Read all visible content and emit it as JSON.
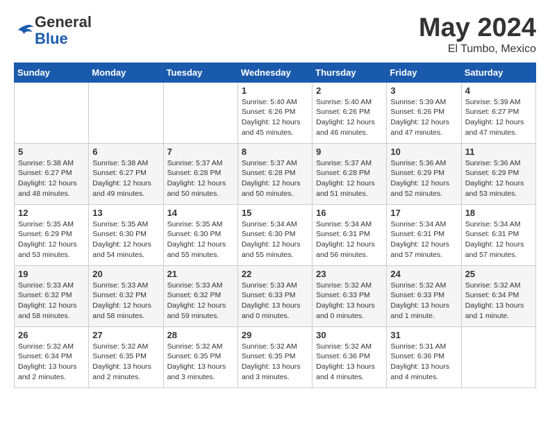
{
  "logo": {
    "general": "General",
    "blue": "Blue"
  },
  "title": "May 2024",
  "location": "El Tumbo, Mexico",
  "days_of_week": [
    "Sunday",
    "Monday",
    "Tuesday",
    "Wednesday",
    "Thursday",
    "Friday",
    "Saturday"
  ],
  "weeks": [
    [
      {
        "day": "",
        "info": ""
      },
      {
        "day": "",
        "info": ""
      },
      {
        "day": "",
        "info": ""
      },
      {
        "day": "1",
        "info": "Sunrise: 5:40 AM\nSunset: 6:26 PM\nDaylight: 12 hours\nand 45 minutes."
      },
      {
        "day": "2",
        "info": "Sunrise: 5:40 AM\nSunset: 6:26 PM\nDaylight: 12 hours\nand 46 minutes."
      },
      {
        "day": "3",
        "info": "Sunrise: 5:39 AM\nSunset: 6:26 PM\nDaylight: 12 hours\nand 47 minutes."
      },
      {
        "day": "4",
        "info": "Sunrise: 5:39 AM\nSunset: 6:27 PM\nDaylight: 12 hours\nand 47 minutes."
      }
    ],
    [
      {
        "day": "5",
        "info": "Sunrise: 5:38 AM\nSunset: 6:27 PM\nDaylight: 12 hours\nand 48 minutes."
      },
      {
        "day": "6",
        "info": "Sunrise: 5:38 AM\nSunset: 6:27 PM\nDaylight: 12 hours\nand 49 minutes."
      },
      {
        "day": "7",
        "info": "Sunrise: 5:37 AM\nSunset: 6:28 PM\nDaylight: 12 hours\nand 50 minutes."
      },
      {
        "day": "8",
        "info": "Sunrise: 5:37 AM\nSunset: 6:28 PM\nDaylight: 12 hours\nand 50 minutes."
      },
      {
        "day": "9",
        "info": "Sunrise: 5:37 AM\nSunset: 6:28 PM\nDaylight: 12 hours\nand 51 minutes."
      },
      {
        "day": "10",
        "info": "Sunrise: 5:36 AM\nSunset: 6:29 PM\nDaylight: 12 hours\nand 52 minutes."
      },
      {
        "day": "11",
        "info": "Sunrise: 5:36 AM\nSunset: 6:29 PM\nDaylight: 12 hours\nand 53 minutes."
      }
    ],
    [
      {
        "day": "12",
        "info": "Sunrise: 5:35 AM\nSunset: 6:29 PM\nDaylight: 12 hours\nand 53 minutes."
      },
      {
        "day": "13",
        "info": "Sunrise: 5:35 AM\nSunset: 6:30 PM\nDaylight: 12 hours\nand 54 minutes."
      },
      {
        "day": "14",
        "info": "Sunrise: 5:35 AM\nSunset: 6:30 PM\nDaylight: 12 hours\nand 55 minutes."
      },
      {
        "day": "15",
        "info": "Sunrise: 5:34 AM\nSunset: 6:30 PM\nDaylight: 12 hours\nand 55 minutes."
      },
      {
        "day": "16",
        "info": "Sunrise: 5:34 AM\nSunset: 6:31 PM\nDaylight: 12 hours\nand 56 minutes."
      },
      {
        "day": "17",
        "info": "Sunrise: 5:34 AM\nSunset: 6:31 PM\nDaylight: 12 hours\nand 57 minutes."
      },
      {
        "day": "18",
        "info": "Sunrise: 5:34 AM\nSunset: 6:31 PM\nDaylight: 12 hours\nand 57 minutes."
      }
    ],
    [
      {
        "day": "19",
        "info": "Sunrise: 5:33 AM\nSunset: 6:32 PM\nDaylight: 12 hours\nand 58 minutes."
      },
      {
        "day": "20",
        "info": "Sunrise: 5:33 AM\nSunset: 6:32 PM\nDaylight: 12 hours\nand 58 minutes."
      },
      {
        "day": "21",
        "info": "Sunrise: 5:33 AM\nSunset: 6:32 PM\nDaylight: 12 hours\nand 59 minutes."
      },
      {
        "day": "22",
        "info": "Sunrise: 5:33 AM\nSunset: 6:33 PM\nDaylight: 13 hours\nand 0 minutes."
      },
      {
        "day": "23",
        "info": "Sunrise: 5:32 AM\nSunset: 6:33 PM\nDaylight: 13 hours\nand 0 minutes."
      },
      {
        "day": "24",
        "info": "Sunrise: 5:32 AM\nSunset: 6:33 PM\nDaylight: 13 hours\nand 1 minute."
      },
      {
        "day": "25",
        "info": "Sunrise: 5:32 AM\nSunset: 6:34 PM\nDaylight: 13 hours\nand 1 minute."
      }
    ],
    [
      {
        "day": "26",
        "info": "Sunrise: 5:32 AM\nSunset: 6:34 PM\nDaylight: 13 hours\nand 2 minutes."
      },
      {
        "day": "27",
        "info": "Sunrise: 5:32 AM\nSunset: 6:35 PM\nDaylight: 13 hours\nand 2 minutes."
      },
      {
        "day": "28",
        "info": "Sunrise: 5:32 AM\nSunset: 6:35 PM\nDaylight: 13 hours\nand 3 minutes."
      },
      {
        "day": "29",
        "info": "Sunrise: 5:32 AM\nSunset: 6:35 PM\nDaylight: 13 hours\nand 3 minutes."
      },
      {
        "day": "30",
        "info": "Sunrise: 5:32 AM\nSunset: 6:36 PM\nDaylight: 13 hours\nand 4 minutes."
      },
      {
        "day": "31",
        "info": "Sunrise: 5:31 AM\nSunset: 6:36 PM\nDaylight: 13 hours\nand 4 minutes."
      },
      {
        "day": "",
        "info": ""
      }
    ]
  ]
}
